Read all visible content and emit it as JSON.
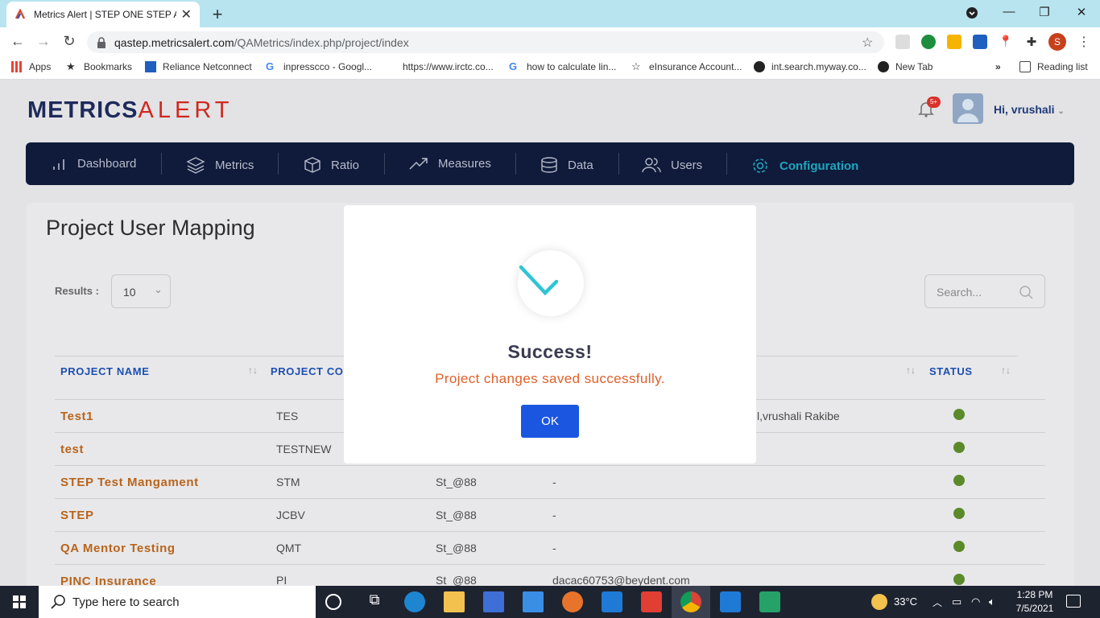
{
  "browser": {
    "tab_title": "Metrics Alert | STEP ONE STEP AH",
    "url_host": "qastep.metricsalert.com",
    "url_path": "/QAMetrics/index.php/project/index",
    "profile_initial": "S",
    "bookmarks": [
      {
        "label": "Apps"
      },
      {
        "label": "Bookmarks"
      },
      {
        "label": "Reliance Netconnect"
      },
      {
        "label": "inpresscco - Googl..."
      },
      {
        "label": "https://www.irctc.co..."
      },
      {
        "label": "how to calculate lin..."
      },
      {
        "label": "eInsurance Account..."
      },
      {
        "label": "int.search.myway.co..."
      },
      {
        "label": "New Tab"
      }
    ],
    "bookmarks_more": "»",
    "reading_list": "Reading list"
  },
  "app": {
    "logo_metrics": "METRICS",
    "logo_alert": "ALERT",
    "notification_badge": "5+",
    "greeting": "Hi,",
    "username": "vrushali",
    "nav": [
      {
        "label": "Dashboard"
      },
      {
        "label": "Metrics"
      },
      {
        "label": "Ratio"
      },
      {
        "label": "Measures"
      },
      {
        "label": "Data"
      },
      {
        "label": "Users"
      },
      {
        "label": "Configuration"
      }
    ],
    "page_title": "Project User Mapping",
    "results_label": "Results :",
    "results_value": "10",
    "search_placeholder": "Search...",
    "columns": [
      "PROJECT NAME",
      "PROJECT CO",
      "STATUS"
    ],
    "rows": [
      {
        "name": "Test1",
        "code": "TES",
        "pass": "",
        "users": "l,vrushali Rakibe"
      },
      {
        "name": "test",
        "code": "TESTNEW",
        "pass": "",
        "users": ""
      },
      {
        "name": "STEP Test Mangament",
        "code": "STM",
        "pass": "St_@88",
        "users": "-"
      },
      {
        "name": "STEP",
        "code": "JCBV",
        "pass": "St_@88",
        "users": "-"
      },
      {
        "name": "QA Mentor Testing",
        "code": "QMT",
        "pass": "St_@88",
        "users": "-"
      },
      {
        "name": "PINC Insurance",
        "code": "PI",
        "pass": "St_@88",
        "users": "dacac60753@beydent.com"
      }
    ],
    "status_color": "#5b8a2a"
  },
  "modal": {
    "title": "Success!",
    "message": "Project changes saved successfully.",
    "ok_label": "OK"
  },
  "taskbar": {
    "search_placeholder": "Type here to search",
    "weather": "33°C",
    "time": "1:28 PM",
    "date": "7/5/2021"
  }
}
